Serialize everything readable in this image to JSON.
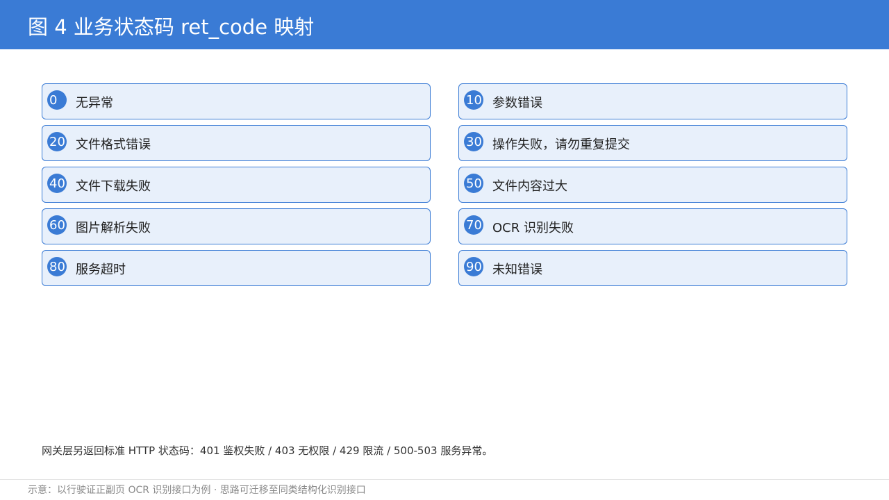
{
  "header": {
    "title": "图 4  业务状态码 ret_code 映射"
  },
  "cards": [
    {
      "code": "0",
      "label": "无异常"
    },
    {
      "code": "10",
      "label": "参数错误"
    },
    {
      "code": "20",
      "label": "文件格式错误"
    },
    {
      "code": "30",
      "label": "操作失败，请勿重复提交"
    },
    {
      "code": "40",
      "label": "文件下载失败"
    },
    {
      "code": "50",
      "label": "文件内容过大"
    },
    {
      "code": "60",
      "label": "图片解析失败"
    },
    {
      "code": "70",
      "label": "OCR 识别失败"
    },
    {
      "code": "80",
      "label": "服务超时"
    },
    {
      "code": "90",
      "label": "未知错误"
    }
  ],
  "note": "网关层另返回标准 HTTP 状态码：401 鉴权失败 / 403 无权限 / 429 限流 / 500-503 服务异常。",
  "footer": "示意：以行驶证正副页 OCR 识别接口为例 · 思路可迁移至同类结构化识别接口",
  "colors": {
    "accent": "#3a7bd5",
    "card_fill": "#e8f0fb"
  }
}
